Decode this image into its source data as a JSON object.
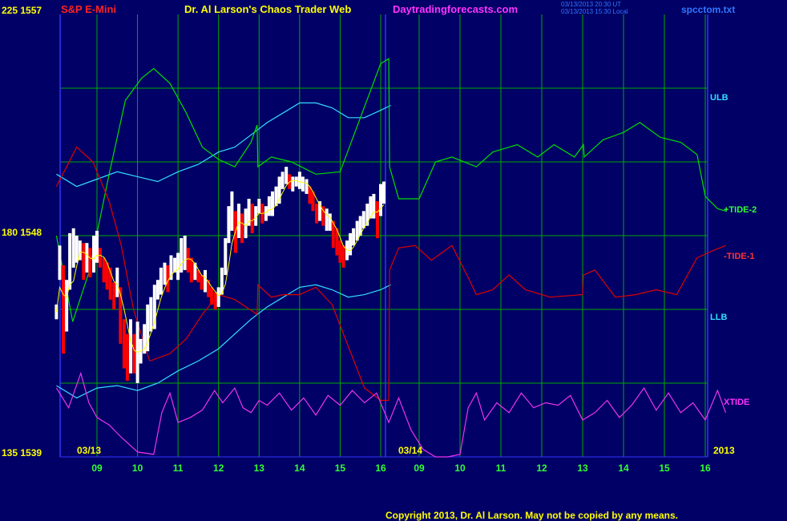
{
  "header": {
    "symbol": "S&P E-Mini",
    "title": "Dr. Al Larson's Chaos Trader Web",
    "site": "Daytradingforecasts.com",
    "stamp_line1": "03/13/2013 20:30 UT",
    "stamp_line2": "03/13/2013 15:30 Local",
    "file": "spcctom.txt"
  },
  "y_labels": {
    "top": "225  1557",
    "mid": "180  1548",
    "bottom": "135  1539"
  },
  "date_labels": {
    "day1": "03/13",
    "day2": "03/14",
    "year": "2013"
  },
  "x_ticks_day1": [
    "09",
    "10",
    "11",
    "12",
    "13",
    "14",
    "15",
    "16"
  ],
  "x_ticks_day2": [
    "09",
    "10",
    "11",
    "12",
    "13",
    "14",
    "15",
    "16"
  ],
  "line_labels": {
    "ulb": "ULB",
    "tide2": "+TIDE-2",
    "tide1": "-TIDE-1",
    "llb": "LLB",
    "xtide": "XTIDE"
  },
  "copyright": "Copyright 2013, Dr. Al Larson. May not be copied by any means.",
  "colors": {
    "background": "#000066",
    "grid": "#00aa00",
    "bullish_bar": "#ffffff",
    "bearish_bar": "#ff0000",
    "tide2": "#00dd00",
    "tide1": "#dd0000",
    "bands": "#33ddff",
    "xtide": "#ee33ee",
    "moving_avg": "#ffff00",
    "ylabel": "#ffff00"
  },
  "chart_data": {
    "type": "line",
    "price_axis": {
      "min": 1539,
      "max": 1557,
      "ticks": [
        1539,
        1548,
        1557
      ]
    },
    "index_axis": {
      "min": 135,
      "max": 225,
      "ticks": [
        135,
        180,
        225
      ]
    },
    "x_axis": "hours 08:00-16:15, two sessions (03/13, 03/14)",
    "price_bars": [
      [
        8.0,
        1544.6,
        1545.2
      ],
      [
        8.08,
        1546.2,
        1547.6
      ],
      [
        8.17,
        1543.2,
        1546.8
      ],
      [
        8.25,
        1544.1,
        1546.2
      ],
      [
        8.33,
        1545.8,
        1548.1
      ],
      [
        8.42,
        1546.7,
        1548.3
      ],
      [
        8.5,
        1546.9,
        1548.0
      ],
      [
        8.58,
        1547.0,
        1547.8
      ],
      [
        8.67,
        1546.2,
        1547.7
      ],
      [
        8.75,
        1546.5,
        1547.7
      ],
      [
        8.83,
        1546.3,
        1547.5
      ],
      [
        8.92,
        1546.5,
        1548.0
      ],
      [
        9.0,
        1546.9,
        1548.2
      ],
      [
        9.08,
        1546.7,
        1547.5
      ],
      [
        9.17,
        1546.1,
        1547.1
      ],
      [
        9.25,
        1545.8,
        1546.9
      ],
      [
        9.33,
        1545.4,
        1546.7
      ],
      [
        9.42,
        1545.0,
        1546.1
      ],
      [
        9.5,
        1545.5,
        1546.7
      ],
      [
        9.58,
        1543.6,
        1545.9
      ],
      [
        9.67,
        1542.6,
        1544.6
      ],
      [
        9.75,
        1542.1,
        1544.0
      ],
      [
        9.83,
        1542.4,
        1544.6
      ],
      [
        9.92,
        1542.4,
        1544.0
      ],
      [
        10.0,
        1542.0,
        1544.5
      ],
      [
        10.08,
        1542.8,
        1543.8
      ],
      [
        10.17,
        1543.2,
        1544.4
      ],
      [
        10.25,
        1543.3,
        1545.2
      ],
      [
        10.33,
        1544.1,
        1545.5
      ],
      [
        10.42,
        1544.2,
        1546.0
      ],
      [
        10.5,
        1545.4,
        1546.2
      ],
      [
        10.58,
        1545.6,
        1546.7
      ],
      [
        10.67,
        1546.0,
        1546.9
      ],
      [
        10.75,
        1545.7,
        1546.8
      ],
      [
        10.83,
        1546.2,
        1547.2
      ],
      [
        10.92,
        1546.5,
        1547.1
      ],
      [
        11.0,
        1546.2,
        1547.3
      ],
      [
        11.08,
        1546.5,
        1547.9
      ],
      [
        11.17,
        1546.6,
        1548.0
      ],
      [
        11.25,
        1546.5,
        1547.5
      ],
      [
        11.33,
        1546.1,
        1547.1
      ],
      [
        11.42,
        1546.2,
        1546.9
      ],
      [
        11.5,
        1546.1,
        1546.6
      ],
      [
        11.58,
        1545.8,
        1546.4
      ],
      [
        11.67,
        1545.7,
        1546.6
      ],
      [
        11.75,
        1545.5,
        1546.2
      ],
      [
        11.83,
        1545.2,
        1545.9
      ],
      [
        11.92,
        1545.0,
        1545.7
      ],
      [
        12.0,
        1545.1,
        1545.9
      ],
      [
        12.08,
        1545.6,
        1546.7
      ],
      [
        12.17,
        1546.4,
        1547.9
      ],
      [
        12.25,
        1547.7,
        1549.2
      ],
      [
        12.33,
        1548.2,
        1549.8
      ],
      [
        12.42,
        1547.3,
        1549.0
      ],
      [
        12.5,
        1547.9,
        1549.3
      ],
      [
        12.58,
        1547.7,
        1548.9
      ],
      [
        12.67,
        1547.9,
        1549.1
      ],
      [
        12.75,
        1548.4,
        1549.5
      ],
      [
        12.83,
        1548.1,
        1549.3
      ],
      [
        12.92,
        1548.4,
        1549.2
      ],
      [
        13.0,
        1548.9,
        1549.5
      ],
      [
        13.08,
        1548.5,
        1549.3
      ],
      [
        13.17,
        1548.6,
        1549.2
      ],
      [
        13.25,
        1548.8,
        1549.6
      ],
      [
        13.33,
        1548.8,
        1549.8
      ],
      [
        13.42,
        1549.2,
        1550.0
      ],
      [
        13.5,
        1549.3,
        1550.4
      ],
      [
        13.58,
        1549.9,
        1550.6
      ],
      [
        13.67,
        1550.1,
        1550.8
      ],
      [
        13.75,
        1549.9,
        1550.5
      ],
      [
        13.83,
        1549.8,
        1550.4
      ],
      [
        13.92,
        1550.0,
        1550.4
      ],
      [
        14.0,
        1549.9,
        1550.6
      ],
      [
        14.08,
        1549.8,
        1550.4
      ],
      [
        14.17,
        1549.7,
        1550.3
      ],
      [
        14.25,
        1549.3,
        1550.0
      ],
      [
        14.33,
        1549.0,
        1549.8
      ],
      [
        14.42,
        1548.5,
        1549.3
      ],
      [
        14.5,
        1548.6,
        1549.4
      ],
      [
        14.58,
        1548.4,
        1549.2
      ],
      [
        14.67,
        1548.2,
        1549.1
      ],
      [
        14.75,
        1548.2,
        1548.9
      ],
      [
        14.83,
        1547.5,
        1548.6
      ],
      [
        14.92,
        1547.2,
        1548.3
      ],
      [
        15.0,
        1546.9,
        1547.8
      ],
      [
        15.08,
        1546.7,
        1547.6
      ],
      [
        15.17,
        1547.0,
        1547.8
      ],
      [
        15.25,
        1547.2,
        1548.1
      ],
      [
        15.33,
        1547.6,
        1548.3
      ],
      [
        15.42,
        1547.8,
        1548.6
      ],
      [
        15.5,
        1548.0,
        1548.8
      ],
      [
        15.58,
        1548.3,
        1549.0
      ],
      [
        15.67,
        1548.4,
        1549.3
      ],
      [
        15.75,
        1548.7,
        1549.6
      ],
      [
        15.83,
        1548.7,
        1549.7
      ],
      [
        15.92,
        1547.9,
        1549.4
      ],
      [
        16.0,
        1548.8,
        1550.1
      ],
      [
        16.08,
        1549.3,
        1550.2
      ]
    ],
    "series": [
      {
        "name": "ULB",
        "points": [
          [
            8,
            1550.5
          ],
          [
            8.5,
            1550
          ],
          [
            9,
            1550.3
          ],
          [
            9.5,
            1550.6
          ],
          [
            10,
            1550.4
          ],
          [
            10.5,
            1550.2
          ],
          [
            11,
            1550.6
          ],
          [
            11.5,
            1550.9
          ],
          [
            12,
            1551.4
          ],
          [
            12.4,
            1551.6
          ],
          [
            12.8,
            1552.1
          ],
          [
            13.2,
            1552.6
          ],
          [
            13.6,
            1553.0
          ],
          [
            14,
            1553.4
          ],
          [
            14.4,
            1553.4
          ],
          [
            14.8,
            1553.2
          ],
          [
            15.2,
            1552.8
          ],
          [
            15.6,
            1552.8
          ],
          [
            16,
            1553.1
          ],
          [
            16.25,
            1553.3
          ]
        ]
      },
      {
        "name": "LLB",
        "points": [
          [
            8,
            1541.9
          ],
          [
            8.5,
            1541.4
          ],
          [
            9,
            1541.8
          ],
          [
            9.5,
            1541.9
          ],
          [
            10,
            1541.7
          ],
          [
            10.5,
            1542.0
          ],
          [
            11,
            1542.5
          ],
          [
            11.5,
            1542.9
          ],
          [
            12,
            1543.4
          ],
          [
            12.4,
            1544.0
          ],
          [
            12.8,
            1544.6
          ],
          [
            13.2,
            1545.1
          ],
          [
            13.6,
            1545.5
          ],
          [
            14,
            1545.9
          ],
          [
            14.4,
            1546.0
          ],
          [
            14.8,
            1545.8
          ],
          [
            15.2,
            1545.5
          ],
          [
            15.6,
            1545.6
          ],
          [
            16,
            1545.8
          ],
          [
            16.25,
            1546.0
          ]
        ]
      },
      {
        "name": "+TIDE-2",
        "points": [
          [
            8,
            1548.0
          ],
          [
            8.4,
            1544.5
          ],
          [
            8.8,
            1546.5
          ],
          [
            9.3,
            1550.5
          ],
          [
            9.7,
            1553.5
          ],
          [
            10.1,
            1554.4
          ],
          [
            10.4,
            1554.8
          ],
          [
            10.8,
            1554.2
          ],
          [
            11.2,
            1553.0
          ],
          [
            11.6,
            1551.6
          ],
          [
            12.0,
            1551.1
          ],
          [
            12.4,
            1550.8
          ],
          [
            12.8,
            1551.8
          ],
          [
            12.95,
            1552.5
          ],
          [
            12.97,
            1550.8
          ],
          [
            13.3,
            1551.2
          ],
          [
            13.8,
            1551.0
          ],
          [
            14.4,
            1550.5
          ],
          [
            15.0,
            1550.6
          ],
          [
            15.5,
            1552.8
          ],
          [
            16.0,
            1555.0
          ],
          [
            16.2,
            1555.2
          ],
          [
            16.22,
            1550.8
          ],
          [
            16.5,
            1549.5
          ],
          [
            17.0,
            1549.5
          ],
          [
            17.4,
            1551.0
          ],
          [
            17.8,
            1551.2
          ],
          [
            18.4,
            1550.8
          ],
          [
            18.8,
            1551.4
          ],
          [
            19.4,
            1551.7
          ],
          [
            19.9,
            1551.2
          ],
          [
            20.3,
            1551.7
          ],
          [
            20.8,
            1551.2
          ],
          [
            21.02,
            1551.7
          ],
          [
            21.04,
            1551.2
          ],
          [
            21.5,
            1551.9
          ],
          [
            22.0,
            1552.2
          ],
          [
            22.4,
            1552.6
          ],
          [
            22.9,
            1552.0
          ],
          [
            23.4,
            1551.8
          ],
          [
            23.8,
            1551.3
          ],
          [
            24.0,
            1549.6
          ],
          [
            24.3,
            1549.1
          ],
          [
            24.5,
            1549.0
          ]
        ]
      },
      {
        "name": "-TIDE-1",
        "points": [
          [
            8,
            1550.0
          ],
          [
            8.5,
            1551.6
          ],
          [
            8.9,
            1551.0
          ],
          [
            9.3,
            1549.4
          ],
          [
            9.6,
            1547.6
          ],
          [
            9.9,
            1545.0
          ],
          [
            10.3,
            1542.9
          ],
          [
            10.8,
            1543.2
          ],
          [
            11.2,
            1543.8
          ],
          [
            11.6,
            1544.8
          ],
          [
            12.0,
            1545.6
          ],
          [
            12.4,
            1545.4
          ],
          [
            12.95,
            1544.8
          ],
          [
            12.97,
            1546.0
          ],
          [
            13.3,
            1545.5
          ],
          [
            13.6,
            1545.6
          ],
          [
            14.0,
            1545.6
          ],
          [
            14.4,
            1545.9
          ],
          [
            14.8,
            1545.2
          ],
          [
            15.2,
            1543.5
          ],
          [
            15.6,
            1541.8
          ],
          [
            16.0,
            1541.3
          ],
          [
            16.2,
            1541.3
          ],
          [
            16.22,
            1546.6
          ],
          [
            16.5,
            1547.5
          ],
          [
            16.9,
            1547.6
          ],
          [
            17.3,
            1547.0
          ],
          [
            17.8,
            1547.6
          ],
          [
            18.2,
            1546.3
          ],
          [
            18.4,
            1545.6
          ],
          [
            18.8,
            1545.8
          ],
          [
            19.2,
            1546.4
          ],
          [
            19.6,
            1545.8
          ],
          [
            20.2,
            1545.5
          ],
          [
            21.0,
            1545.6
          ],
          [
            21.02,
            1546.4
          ],
          [
            21.3,
            1546.6
          ],
          [
            21.8,
            1545.5
          ],
          [
            22.3,
            1545.6
          ],
          [
            22.8,
            1545.8
          ],
          [
            23.3,
            1545.6
          ],
          [
            23.8,
            1547.1
          ],
          [
            24.2,
            1547.4
          ],
          [
            24.5,
            1547.6
          ]
        ]
      },
      {
        "name": "XTIDE",
        "points": [
          [
            8,
            1541.8
          ],
          [
            8.3,
            1541.0
          ],
          [
            8.6,
            1542.4
          ],
          [
            8.8,
            1541.2
          ],
          [
            9.0,
            1540.6
          ],
          [
            9.3,
            1540.3
          ],
          [
            9.6,
            1539.8
          ],
          [
            10.0,
            1539.2
          ],
          [
            10.4,
            1539.1
          ],
          [
            10.6,
            1540.8
          ],
          [
            10.8,
            1541.6
          ],
          [
            11.0,
            1540.4
          ],
          [
            11.3,
            1540.6
          ],
          [
            11.6,
            1540.9
          ],
          [
            11.9,
            1541.7
          ],
          [
            12.1,
            1541.2
          ],
          [
            12.4,
            1541.8
          ],
          [
            12.6,
            1541.0
          ],
          [
            12.8,
            1540.8
          ],
          [
            13.0,
            1541.3
          ],
          [
            13.2,
            1541.1
          ],
          [
            13.5,
            1541.6
          ],
          [
            13.8,
            1540.9
          ],
          [
            14.1,
            1541.4
          ],
          [
            14.4,
            1540.7
          ],
          [
            14.7,
            1541.5
          ],
          [
            15.0,
            1541.1
          ],
          [
            15.3,
            1541.7
          ],
          [
            15.6,
            1541.2
          ],
          [
            15.9,
            1541.6
          ],
          [
            16.2,
            1540.4
          ],
          [
            16.5,
            1541.4
          ],
          [
            16.8,
            1540.1
          ],
          [
            17.1,
            1539.3
          ],
          [
            17.4,
            1539.0
          ],
          [
            17.7,
            1539.0
          ],
          [
            18.0,
            1539.1
          ],
          [
            18.2,
            1541.0
          ],
          [
            18.4,
            1541.6
          ],
          [
            18.6,
            1540.5
          ],
          [
            18.9,
            1541.2
          ],
          [
            19.2,
            1540.8
          ],
          [
            19.5,
            1541.6
          ],
          [
            19.8,
            1541.0
          ],
          [
            20.1,
            1541.2
          ],
          [
            20.4,
            1541.1
          ],
          [
            20.7,
            1541.5
          ],
          [
            21.0,
            1540.5
          ],
          [
            21.3,
            1540.8
          ],
          [
            21.6,
            1541.3
          ],
          [
            21.9,
            1540.6
          ],
          [
            22.2,
            1541.1
          ],
          [
            22.5,
            1541.8
          ],
          [
            22.8,
            1540.9
          ],
          [
            23.1,
            1541.6
          ],
          [
            23.4,
            1540.8
          ],
          [
            23.7,
            1541.2
          ],
          [
            24.0,
            1540.5
          ],
          [
            24.3,
            1541.7
          ],
          [
            24.5,
            1540.8
          ]
        ]
      }
    ]
  }
}
